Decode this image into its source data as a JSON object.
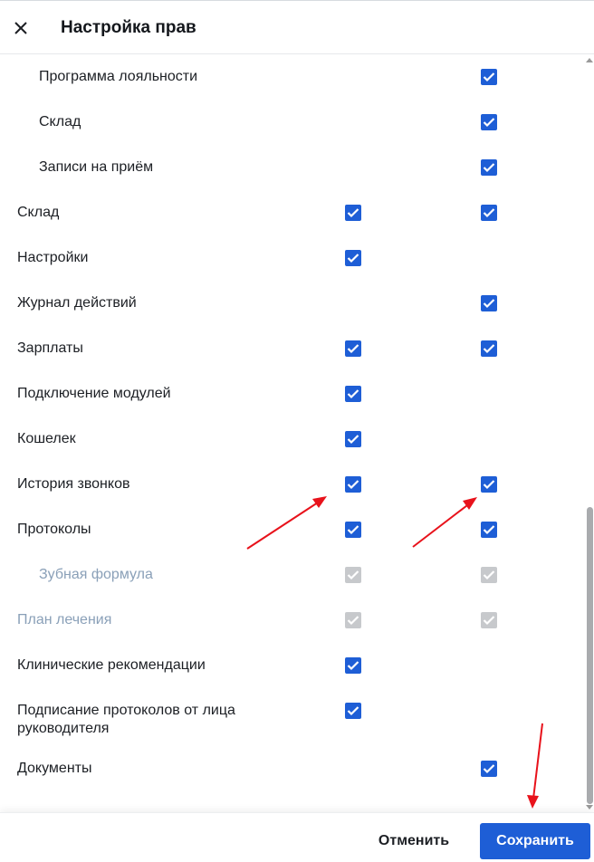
{
  "header": {
    "title": "Настройка прав",
    "close_icon": "close-icon"
  },
  "rows": [
    {
      "label": "Программа лояльности",
      "indent": true,
      "disabled": false,
      "col1": false,
      "col2": true
    },
    {
      "label": "Склад",
      "indent": true,
      "disabled": false,
      "col1": false,
      "col2": true
    },
    {
      "label": "Записи на приём",
      "indent": true,
      "disabled": false,
      "col1": false,
      "col2": true
    },
    {
      "label": "Склад",
      "indent": false,
      "disabled": false,
      "col1": true,
      "col2": true
    },
    {
      "label": "Настройки",
      "indent": false,
      "disabled": false,
      "col1": true,
      "col2": false
    },
    {
      "label": "Журнал действий",
      "indent": false,
      "disabled": false,
      "col1": false,
      "col2": true
    },
    {
      "label": "Зарплаты",
      "indent": false,
      "disabled": false,
      "col1": true,
      "col2": true
    },
    {
      "label": "Подключение модулей",
      "indent": false,
      "disabled": false,
      "col1": true,
      "col2": false
    },
    {
      "label": "Кошелек",
      "indent": false,
      "disabled": false,
      "col1": true,
      "col2": false
    },
    {
      "label": "История звонков",
      "indent": false,
      "disabled": false,
      "col1": true,
      "col2": true
    },
    {
      "label": "Протоколы",
      "indent": false,
      "disabled": false,
      "col1": true,
      "col2": true
    },
    {
      "label": "Зубная формула",
      "indent": true,
      "disabled": true,
      "col1": true,
      "col2": true
    },
    {
      "label": "План лечения",
      "indent": false,
      "disabled": true,
      "col1": true,
      "col2": true
    },
    {
      "label": "Клинические рекомендации",
      "indent": false,
      "disabled": false,
      "col1": true,
      "col2": false
    },
    {
      "label": "Подписание протоколов от лица руководителя",
      "indent": false,
      "disabled": false,
      "col1": true,
      "col2": false,
      "tall": true
    },
    {
      "label": "Документы",
      "indent": false,
      "disabled": false,
      "col1": false,
      "col2": true
    }
  ],
  "footer": {
    "cancel_label": "Отменить",
    "save_label": "Сохранить"
  },
  "colors": {
    "accent": "#1e5ed6",
    "disabled_checkbox": "#c7c9cc",
    "disabled_text": "#8aa0b8",
    "annotation_arrow": "#e8121b"
  }
}
